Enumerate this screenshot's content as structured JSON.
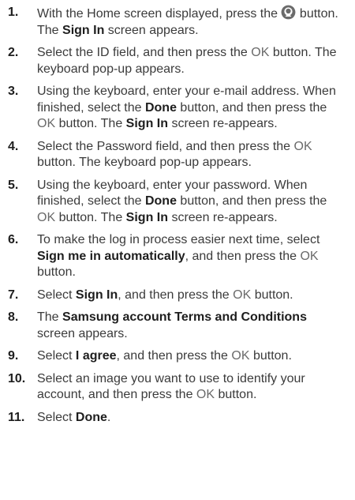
{
  "steps": [
    {
      "number": "1.",
      "t1": "With the Home screen displayed, press the ",
      "icon": "account-person-icon",
      "t2": " button. The ",
      "b1": "Sign In",
      "t3": " screen appears."
    },
    {
      "number": "2.",
      "t1": "Select the ID field, and then press the ",
      "ok": "OK",
      "t2": " button. The keyboard pop-up appears."
    },
    {
      "number": "3.",
      "t1": "Using the keyboard, enter your e-mail address. When finished, select the ",
      "b1": "Done",
      "t2": " button, and then press the ",
      "ok": "OK",
      "t3": " button. The ",
      "b2": "Sign In",
      "t4": " screen re-appears."
    },
    {
      "number": "4.",
      "t1": "Select the Password field, and then press the ",
      "ok": "OK",
      "t2": " button. The keyboard pop-up appears."
    },
    {
      "number": "5.",
      "t1": "Using the keyboard, enter your password. When finished, select the ",
      "b1": "Done",
      "t2": " button, and then press the ",
      "ok": "OK",
      "t3": " button. The ",
      "b2": "Sign In",
      "t4": " screen re-appears."
    },
    {
      "number": "6.",
      "t1": "To make the log in process easier next time, select ",
      "b1": "Sign me in automatically",
      "t2": ", and then press the ",
      "ok": "OK",
      "t3": " button."
    },
    {
      "number": "7.",
      "t1": "Select ",
      "b1": "Sign In",
      "t2": ", and then press the ",
      "ok": "OK",
      "t3": " button."
    },
    {
      "number": "8.",
      "t1": "The ",
      "b1": "Samsung account Terms and Conditions",
      "t2": " screen appears."
    },
    {
      "number": "9.",
      "t1": "Select ",
      "b1": "I agree",
      "t2": ", and then press the ",
      "ok": "OK",
      "t3": " button."
    },
    {
      "number": "10.",
      "t1": "Select an image you want to use to identify your account, and then press the ",
      "ok": "OK",
      "t2": " button."
    },
    {
      "number": "11.",
      "t1": "Select ",
      "b1": "Done",
      "t2": "."
    }
  ]
}
